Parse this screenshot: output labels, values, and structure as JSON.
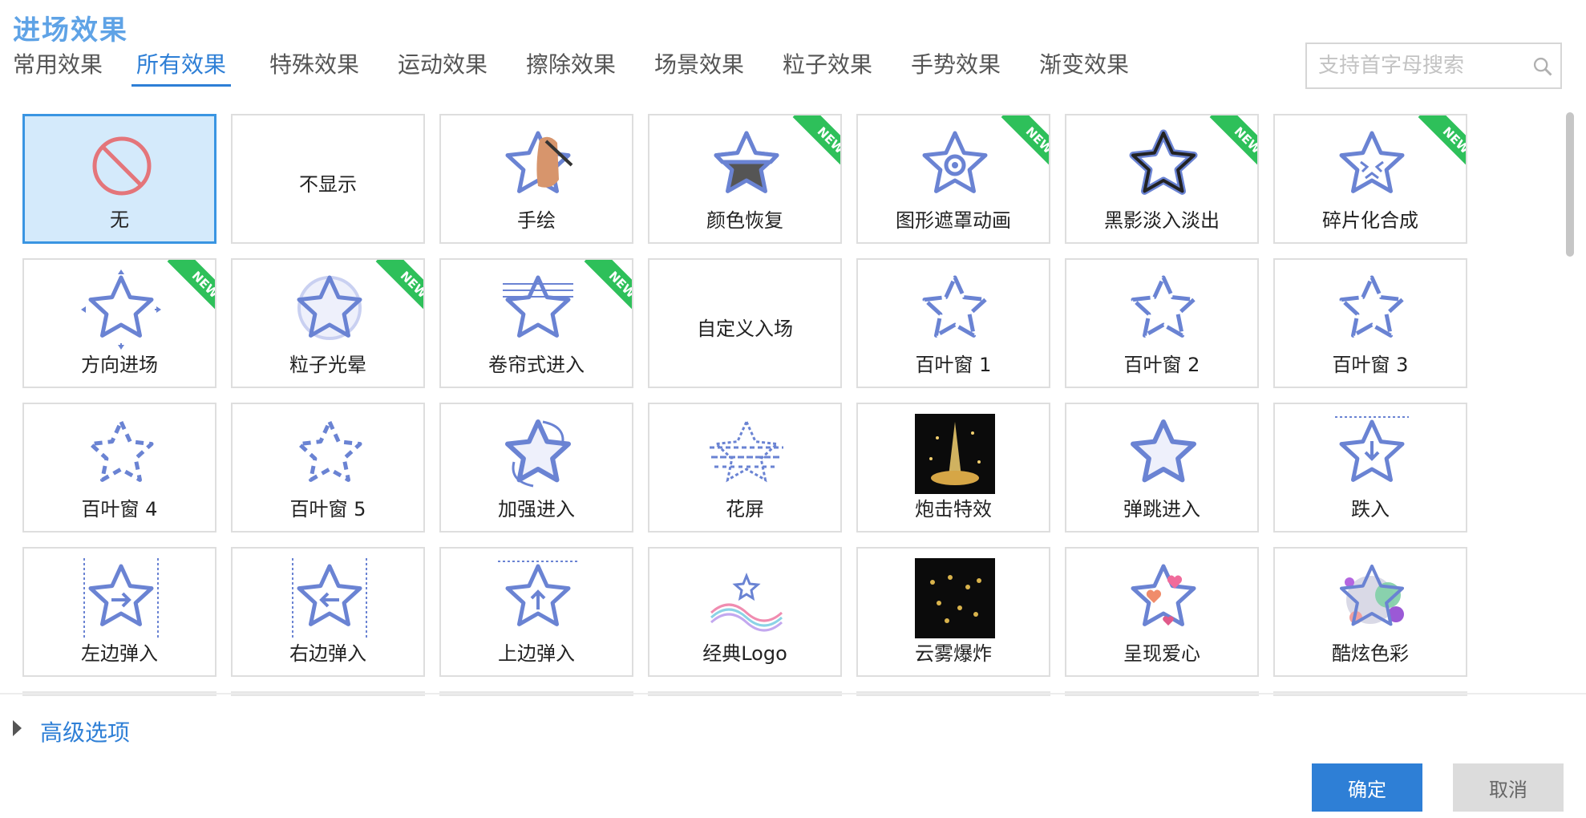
{
  "title": "进场效果",
  "tabs": [
    {
      "label": "常用效果",
      "active": false
    },
    {
      "label": "所有效果",
      "active": true
    },
    {
      "label": "特殊效果",
      "active": false
    },
    {
      "label": "运动效果",
      "active": false
    },
    {
      "label": "擦除效果",
      "active": false
    },
    {
      "label": "场景效果",
      "active": false
    },
    {
      "label": "粒子效果",
      "active": false
    },
    {
      "label": "手势效果",
      "active": false
    },
    {
      "label": "渐变效果",
      "active": false
    }
  ],
  "search": {
    "placeholder": "支持首字母搜索",
    "value": ""
  },
  "new_badge": "NEW",
  "colors": {
    "accent": "#2e7fd6",
    "star": "#6a83d3",
    "new_ribbon": "#2ec05a",
    "selected_bg": "#d4eafb"
  },
  "effects": [
    {
      "label": "无",
      "icon": "no-icon",
      "is_new": false,
      "selected": true
    },
    {
      "label": "不显示",
      "icon": "none",
      "is_new": false,
      "selected": false
    },
    {
      "label": "手绘",
      "icon": "hand-draw-icon",
      "is_new": false,
      "selected": false
    },
    {
      "label": "颜色恢复",
      "icon": "color-restore-icon",
      "is_new": true,
      "selected": false
    },
    {
      "label": "图形遮罩动画",
      "icon": "shape-mask-icon",
      "is_new": true,
      "selected": false
    },
    {
      "label": "黑影淡入淡出",
      "icon": "shadow-fade-icon",
      "is_new": true,
      "selected": false
    },
    {
      "label": "碎片化合成",
      "icon": "fragment-icon",
      "is_new": true,
      "selected": false
    },
    {
      "label": "方向进场",
      "icon": "direction-icon",
      "is_new": true,
      "selected": false
    },
    {
      "label": "粒子光晕",
      "icon": "particle-glow-icon",
      "is_new": true,
      "selected": false
    },
    {
      "label": "卷帘式进入",
      "icon": "roller-blind-icon",
      "is_new": true,
      "selected": false
    },
    {
      "label": "自定义入场",
      "icon": "none",
      "is_new": false,
      "selected": false
    },
    {
      "label": "百叶窗 1",
      "icon": "blinds-icon",
      "is_new": false,
      "selected": false
    },
    {
      "label": "百叶窗 2",
      "icon": "blinds-icon",
      "is_new": false,
      "selected": false
    },
    {
      "label": "百叶窗 3",
      "icon": "blinds-icon",
      "is_new": false,
      "selected": false
    },
    {
      "label": "百叶窗 4",
      "icon": "blinds-dashed-icon",
      "is_new": false,
      "selected": false
    },
    {
      "label": "百叶窗 5",
      "icon": "blinds-dashed-icon",
      "is_new": false,
      "selected": false
    },
    {
      "label": "加强进入",
      "icon": "enhance-icon",
      "is_new": false,
      "selected": false
    },
    {
      "label": "花屏",
      "icon": "glitch-icon",
      "is_new": false,
      "selected": false
    },
    {
      "label": "炮击特效",
      "icon": "cannon-effect-thumbnail",
      "is_new": false,
      "selected": false
    },
    {
      "label": "弹跳进入",
      "icon": "bounce-icon",
      "is_new": false,
      "selected": false
    },
    {
      "label": "跌入",
      "icon": "drop-in-icon",
      "is_new": false,
      "selected": false
    },
    {
      "label": "左边弹入",
      "icon": "bounce-left-icon",
      "is_new": false,
      "selected": false
    },
    {
      "label": "右边弹入",
      "icon": "bounce-right-icon",
      "is_new": false,
      "selected": false
    },
    {
      "label": "上边弹入",
      "icon": "bounce-top-icon",
      "is_new": false,
      "selected": false
    },
    {
      "label": "经典Logo",
      "icon": "logo-icon",
      "is_new": false,
      "selected": false
    },
    {
      "label": "云雾爆炸",
      "icon": "cloud-explosion-thumbnail",
      "is_new": false,
      "selected": false
    },
    {
      "label": "呈现爱心",
      "icon": "heart-icon",
      "is_new": false,
      "selected": false
    },
    {
      "label": "酷炫色彩",
      "icon": "color-burst-icon",
      "is_new": false,
      "selected": false
    }
  ],
  "advanced_options": {
    "label": "高级选项"
  },
  "buttons": {
    "ok": "确定",
    "cancel": "取消"
  }
}
